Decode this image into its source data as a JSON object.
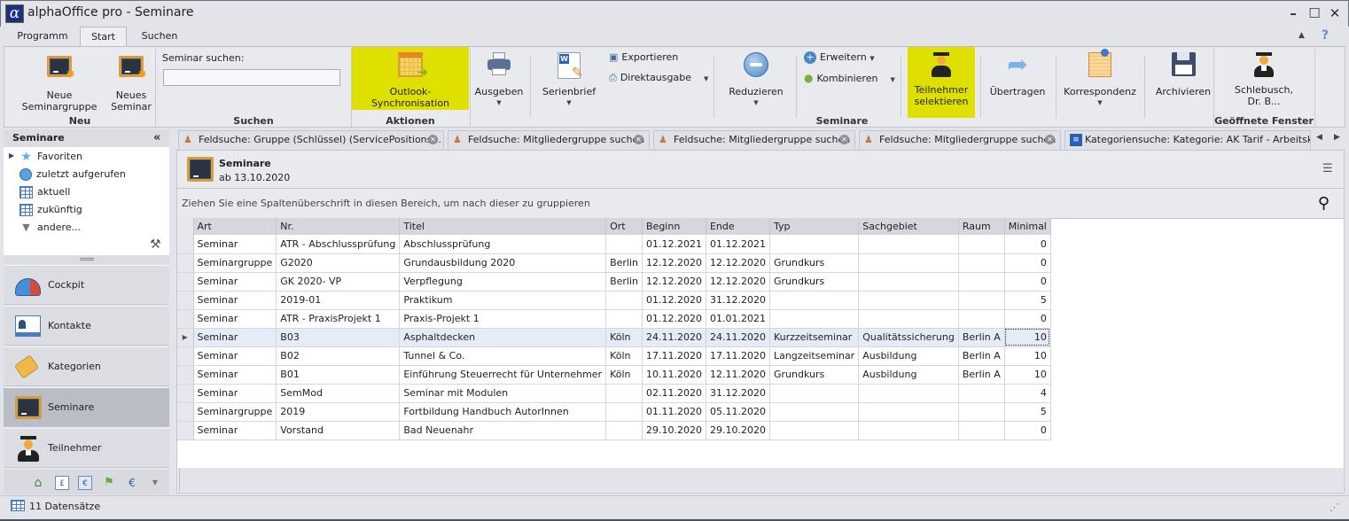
{
  "window": {
    "title": "alphaOffice pro - Seminare",
    "logo_glyph": "α",
    "minimize": "–",
    "maximize": "☐",
    "close": "✕"
  },
  "ribbon_tabs": [
    {
      "label": "Programm",
      "active": false
    },
    {
      "label": "Start",
      "active": true
    },
    {
      "label": "Suchen",
      "active": false
    }
  ],
  "ribbon_right": {
    "collapse_glyph": "▲",
    "help_glyph": "?"
  },
  "ribbon": {
    "neu": {
      "label": "Neu",
      "neue_seminargruppe": "Neue Seminargruppe",
      "neues_seminar_1": "Neues",
      "neues_seminar_2": "Seminar"
    },
    "suchen": {
      "label": "Suchen",
      "search_label": "Seminar suchen:",
      "search_value": "",
      "search_placeholder": ""
    },
    "aktionen": {
      "label": "Aktionen",
      "outlook_sync": "Outlook-Synchronisation"
    },
    "seminare": {
      "label": "Seminare",
      "ausgeben": "Ausgeben",
      "serienbrief": "Serienbrief",
      "exportieren": "Exportieren",
      "direktausgabe": "Direktausgabe",
      "reduzieren": "Reduzieren",
      "erweitern": "Erweitern",
      "kombinieren": "Kombinieren",
      "teilnehmer_1": "Teilnehmer",
      "teilnehmer_2": "selektieren",
      "uebertragen": "Übertragen",
      "korrespondenz": "Korrespondenz",
      "archivieren": "Archivieren"
    },
    "geoeffnete_fenster": {
      "label": "Geöffnete Fenster",
      "item_1": "Schlebusch,",
      "item_2": "Dr. B..."
    },
    "highlight_color": "#e0e000"
  },
  "left_panel": {
    "title": "Seminare",
    "collapse_glyph": "«",
    "tree": [
      {
        "label": "Favoriten",
        "icon": "star-icon"
      },
      {
        "label": "zuletzt aufgerufen",
        "icon": "history-icon"
      },
      {
        "label": "aktuell",
        "icon": "grid-icon"
      },
      {
        "label": "zukünftig",
        "icon": "grid-icon"
      },
      {
        "label": "andere...",
        "icon": "filter-icon"
      }
    ],
    "nav": [
      {
        "label": "Cockpit",
        "active": false
      },
      {
        "label": "Kontakte",
        "active": false
      },
      {
        "label": "Kategorien",
        "active": false
      },
      {
        "label": "Seminare",
        "active": true
      },
      {
        "label": "Teilnehmer",
        "active": false
      }
    ]
  },
  "doc_tabs": [
    {
      "label": "Feldsuche: Gruppe (Schlüssel) (ServicePositions..."
    },
    {
      "label": "Feldsuche: Mitgliedergruppe suchen"
    },
    {
      "label": "Feldsuche: Mitgliedergruppe suchen"
    },
    {
      "label": "Feldsuche: Mitgliedergruppe suchen"
    },
    {
      "label": "Kategoriensuche: Kategorie: AK Tarif - Arbeitsk..."
    }
  ],
  "content": {
    "title": "Seminare",
    "subtitle": "ab 13.10.2020",
    "group_hint": "Ziehen Sie eine Spaltenüberschrift in diesen Bereich, um nach dieser zu gruppieren"
  },
  "grid": {
    "columns": [
      "Art",
      "Nr.",
      "Titel",
      "Ort",
      "Beginn",
      "Ende",
      "Typ",
      "Sachgebiet",
      "Raum",
      "Minimal"
    ],
    "rows": [
      [
        "Seminar",
        "ATR - Abschlussprüfung",
        "Abschlussprüfung",
        "",
        "01.12.2021",
        "01.12.2021",
        "",
        "",
        "",
        "0"
      ],
      [
        "Seminargruppe",
        "G2020",
        "Grundausbildung 2020",
        "Berlin",
        "12.12.2020",
        "12.12.2020",
        "Grundkurs",
        "",
        "",
        "0"
      ],
      [
        "Seminar",
        "GK 2020- VP",
        "Verpflegung",
        "Berlin",
        "12.12.2020",
        "12.12.2020",
        "Grundkurs",
        "",
        "",
        "0"
      ],
      [
        "Seminar",
        "2019-01",
        "Praktikum",
        "",
        "01.12.2020",
        "31.12.2020",
        "",
        "",
        "",
        "5"
      ],
      [
        "Seminar",
        "ATR - PraxisProjekt 1",
        "Praxis-Projekt 1",
        "",
        "01.12.2020",
        "01.01.2021",
        "",
        "",
        "",
        "0"
      ],
      [
        "Seminar",
        "B03",
        "Asphaltdecken",
        "Köln",
        "24.11.2020",
        "24.11.2020",
        "Kurzzeitseminar",
        "Qualitätssicherung",
        "Berlin A",
        "10"
      ],
      [
        "Seminar",
        "B02",
        "Tunnel & Co.",
        "Köln",
        "17.11.2020",
        "17.11.2020",
        "Langzeitseminar",
        "Ausbildung",
        "Berlin A",
        "10"
      ],
      [
        "Seminar",
        "B01",
        "Einführung Steuerrecht für Unternehmer",
        "Köln",
        "10.11.2020",
        "12.11.2020",
        "Grundkurs",
        "Ausbildung",
        "Berlin A",
        "10"
      ],
      [
        "Seminar",
        "SemMod",
        "Seminar mit Modulen",
        "",
        "02.11.2020",
        "31.12.2020",
        "",
        "",
        "",
        "4"
      ],
      [
        "Seminargruppe",
        "2019",
        "Fortbildung Handbuch AutorInnen",
        "",
        "01.11.2020",
        "05.11.2020",
        "",
        "",
        "",
        "5"
      ],
      [
        "Seminar",
        "Vorstand",
        "Bad Neuenahr",
        "",
        "29.10.2020",
        "29.10.2020",
        "",
        "",
        "",
        "0"
      ]
    ],
    "selected_row": 5
  },
  "status": {
    "text": "11 Datensätze"
  }
}
